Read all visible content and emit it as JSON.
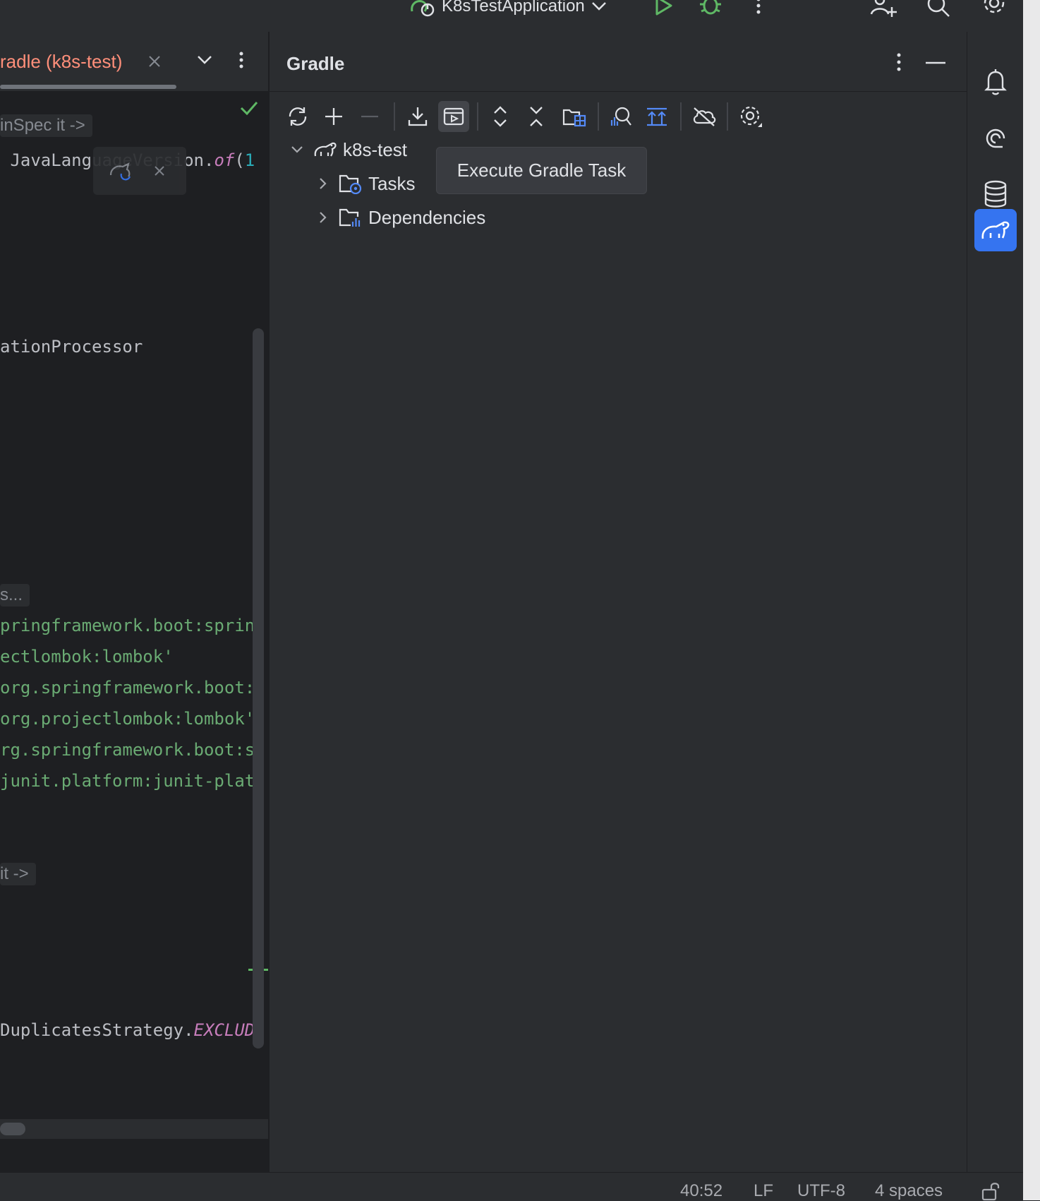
{
  "topbar": {
    "run_config": "K8sTestApplication"
  },
  "editor": {
    "tab_label": "radle (k8s-test)",
    "lines": [
      {
        "parts": [
          {
            "cls": "c-plain",
            "text": " JavaLanguageVersion."
          },
          {
            "cls": "c-italic",
            "text": "of"
          },
          {
            "cls": "c-plain",
            "text": "("
          },
          {
            "cls": "c-num",
            "text": "1"
          }
        ]
      },
      {
        "parts": [
          {
            "cls": "c-plain",
            "text": "ationProcessor"
          }
        ]
      },
      {
        "parts": [
          {
            "cls": "c-string",
            "text": "pringframework.boot:sprin"
          }
        ]
      },
      {
        "parts": [
          {
            "cls": "c-string",
            "text": "ectlombok:lombok'"
          }
        ]
      },
      {
        "parts": [
          {
            "cls": "c-string",
            "text": "org.springframework.boot:"
          }
        ]
      },
      {
        "parts": [
          {
            "cls": "c-string",
            "text": "org.projectlombok:lombok'"
          }
        ]
      },
      {
        "parts": [
          {
            "cls": "c-string",
            "text": "rg.springframework.boot:s"
          }
        ]
      },
      {
        "parts": [
          {
            "cls": "c-string",
            "text": "junit.platform:junit-plat"
          }
        ]
      },
      {
        "parts": [
          {
            "cls": "c-plain",
            "text": "DuplicatesStrategy."
          },
          {
            "cls": "c-italic",
            "text": "EXCLUD"
          }
        ]
      }
    ],
    "inlays": [
      "inSpec it ->",
      "s...",
      " it ->"
    ]
  },
  "gradle": {
    "title": "Gradle",
    "tooltip": "Execute Gradle Task",
    "tree": {
      "root": "k8s-test",
      "children": [
        "Tasks",
        "Dependencies"
      ]
    }
  },
  "statusbar": {
    "position": "40:52",
    "line_separator": "LF",
    "encoding": "UTF-8",
    "indent": "4 spaces"
  },
  "colors": {
    "accent": "#3574f0",
    "run_green": "#5fb865",
    "tab_modified": "#ff8f7a"
  }
}
